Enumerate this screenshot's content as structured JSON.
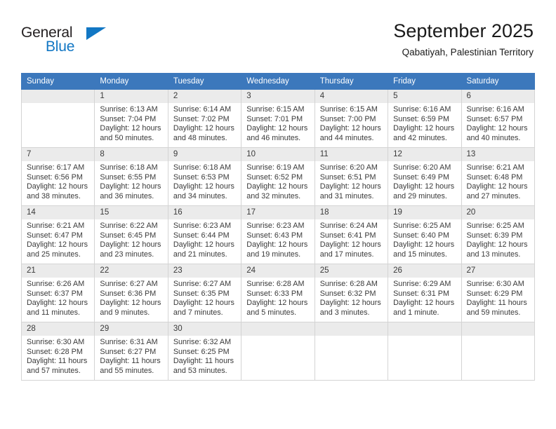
{
  "brand": {
    "name_top": "General",
    "name_bottom": "Blue",
    "accent_color": "#1277c4"
  },
  "header": {
    "title": "September 2025",
    "location": "Qabatiyah, Palestinian Territory"
  },
  "colors": {
    "header_row_bg": "#3c78bc",
    "daynum_bg": "#ebebeb",
    "grid_border": "#d4d4d4",
    "text": "#3a3a3a"
  },
  "weekday_headers": [
    "Sunday",
    "Monday",
    "Tuesday",
    "Wednesday",
    "Thursday",
    "Friday",
    "Saturday"
  ],
  "labels": {
    "sunrise": "Sunrise:",
    "sunset": "Sunset:",
    "daylight": "Daylight:"
  },
  "weeks": [
    [
      {
        "day": "",
        "sunrise": "",
        "sunset": "",
        "daylight_line1": "",
        "daylight_line2": "",
        "empty": true
      },
      {
        "day": "1",
        "sunrise": "Sunrise: 6:13 AM",
        "sunset": "Sunset: 7:04 PM",
        "daylight_line1": "Daylight: 12 hours",
        "daylight_line2": "and 50 minutes."
      },
      {
        "day": "2",
        "sunrise": "Sunrise: 6:14 AM",
        "sunset": "Sunset: 7:02 PM",
        "daylight_line1": "Daylight: 12 hours",
        "daylight_line2": "and 48 minutes."
      },
      {
        "day": "3",
        "sunrise": "Sunrise: 6:15 AM",
        "sunset": "Sunset: 7:01 PM",
        "daylight_line1": "Daylight: 12 hours",
        "daylight_line2": "and 46 minutes."
      },
      {
        "day": "4",
        "sunrise": "Sunrise: 6:15 AM",
        "sunset": "Sunset: 7:00 PM",
        "daylight_line1": "Daylight: 12 hours",
        "daylight_line2": "and 44 minutes."
      },
      {
        "day": "5",
        "sunrise": "Sunrise: 6:16 AM",
        "sunset": "Sunset: 6:59 PM",
        "daylight_line1": "Daylight: 12 hours",
        "daylight_line2": "and 42 minutes."
      },
      {
        "day": "6",
        "sunrise": "Sunrise: 6:16 AM",
        "sunset": "Sunset: 6:57 PM",
        "daylight_line1": "Daylight: 12 hours",
        "daylight_line2": "and 40 minutes."
      }
    ],
    [
      {
        "day": "7",
        "sunrise": "Sunrise: 6:17 AM",
        "sunset": "Sunset: 6:56 PM",
        "daylight_line1": "Daylight: 12 hours",
        "daylight_line2": "and 38 minutes."
      },
      {
        "day": "8",
        "sunrise": "Sunrise: 6:18 AM",
        "sunset": "Sunset: 6:55 PM",
        "daylight_line1": "Daylight: 12 hours",
        "daylight_line2": "and 36 minutes."
      },
      {
        "day": "9",
        "sunrise": "Sunrise: 6:18 AM",
        "sunset": "Sunset: 6:53 PM",
        "daylight_line1": "Daylight: 12 hours",
        "daylight_line2": "and 34 minutes."
      },
      {
        "day": "10",
        "sunrise": "Sunrise: 6:19 AM",
        "sunset": "Sunset: 6:52 PM",
        "daylight_line1": "Daylight: 12 hours",
        "daylight_line2": "and 32 minutes."
      },
      {
        "day": "11",
        "sunrise": "Sunrise: 6:20 AM",
        "sunset": "Sunset: 6:51 PM",
        "daylight_line1": "Daylight: 12 hours",
        "daylight_line2": "and 31 minutes."
      },
      {
        "day": "12",
        "sunrise": "Sunrise: 6:20 AM",
        "sunset": "Sunset: 6:49 PM",
        "daylight_line1": "Daylight: 12 hours",
        "daylight_line2": "and 29 minutes."
      },
      {
        "day": "13",
        "sunrise": "Sunrise: 6:21 AM",
        "sunset": "Sunset: 6:48 PM",
        "daylight_line1": "Daylight: 12 hours",
        "daylight_line2": "and 27 minutes."
      }
    ],
    [
      {
        "day": "14",
        "sunrise": "Sunrise: 6:21 AM",
        "sunset": "Sunset: 6:47 PM",
        "daylight_line1": "Daylight: 12 hours",
        "daylight_line2": "and 25 minutes."
      },
      {
        "day": "15",
        "sunrise": "Sunrise: 6:22 AM",
        "sunset": "Sunset: 6:45 PM",
        "daylight_line1": "Daylight: 12 hours",
        "daylight_line2": "and 23 minutes."
      },
      {
        "day": "16",
        "sunrise": "Sunrise: 6:23 AM",
        "sunset": "Sunset: 6:44 PM",
        "daylight_line1": "Daylight: 12 hours",
        "daylight_line2": "and 21 minutes."
      },
      {
        "day": "17",
        "sunrise": "Sunrise: 6:23 AM",
        "sunset": "Sunset: 6:43 PM",
        "daylight_line1": "Daylight: 12 hours",
        "daylight_line2": "and 19 minutes."
      },
      {
        "day": "18",
        "sunrise": "Sunrise: 6:24 AM",
        "sunset": "Sunset: 6:41 PM",
        "daylight_line1": "Daylight: 12 hours",
        "daylight_line2": "and 17 minutes."
      },
      {
        "day": "19",
        "sunrise": "Sunrise: 6:25 AM",
        "sunset": "Sunset: 6:40 PM",
        "daylight_line1": "Daylight: 12 hours",
        "daylight_line2": "and 15 minutes."
      },
      {
        "day": "20",
        "sunrise": "Sunrise: 6:25 AM",
        "sunset": "Sunset: 6:39 PM",
        "daylight_line1": "Daylight: 12 hours",
        "daylight_line2": "and 13 minutes."
      }
    ],
    [
      {
        "day": "21",
        "sunrise": "Sunrise: 6:26 AM",
        "sunset": "Sunset: 6:37 PM",
        "daylight_line1": "Daylight: 12 hours",
        "daylight_line2": "and 11 minutes."
      },
      {
        "day": "22",
        "sunrise": "Sunrise: 6:27 AM",
        "sunset": "Sunset: 6:36 PM",
        "daylight_line1": "Daylight: 12 hours",
        "daylight_line2": "and 9 minutes."
      },
      {
        "day": "23",
        "sunrise": "Sunrise: 6:27 AM",
        "sunset": "Sunset: 6:35 PM",
        "daylight_line1": "Daylight: 12 hours",
        "daylight_line2": "and 7 minutes."
      },
      {
        "day": "24",
        "sunrise": "Sunrise: 6:28 AM",
        "sunset": "Sunset: 6:33 PM",
        "daylight_line1": "Daylight: 12 hours",
        "daylight_line2": "and 5 minutes."
      },
      {
        "day": "25",
        "sunrise": "Sunrise: 6:28 AM",
        "sunset": "Sunset: 6:32 PM",
        "daylight_line1": "Daylight: 12 hours",
        "daylight_line2": "and 3 minutes."
      },
      {
        "day": "26",
        "sunrise": "Sunrise: 6:29 AM",
        "sunset": "Sunset: 6:31 PM",
        "daylight_line1": "Daylight: 12 hours",
        "daylight_line2": "and 1 minute."
      },
      {
        "day": "27",
        "sunrise": "Sunrise: 6:30 AM",
        "sunset": "Sunset: 6:29 PM",
        "daylight_line1": "Daylight: 11 hours",
        "daylight_line2": "and 59 minutes."
      }
    ],
    [
      {
        "day": "28",
        "sunrise": "Sunrise: 6:30 AM",
        "sunset": "Sunset: 6:28 PM",
        "daylight_line1": "Daylight: 11 hours",
        "daylight_line2": "and 57 minutes."
      },
      {
        "day": "29",
        "sunrise": "Sunrise: 6:31 AM",
        "sunset": "Sunset: 6:27 PM",
        "daylight_line1": "Daylight: 11 hours",
        "daylight_line2": "and 55 minutes."
      },
      {
        "day": "30",
        "sunrise": "Sunrise: 6:32 AM",
        "sunset": "Sunset: 6:25 PM",
        "daylight_line1": "Daylight: 11 hours",
        "daylight_line2": "and 53 minutes."
      },
      {
        "day": "",
        "sunrise": "",
        "sunset": "",
        "daylight_line1": "",
        "daylight_line2": "",
        "empty": true
      },
      {
        "day": "",
        "sunrise": "",
        "sunset": "",
        "daylight_line1": "",
        "daylight_line2": "",
        "empty": true
      },
      {
        "day": "",
        "sunrise": "",
        "sunset": "",
        "daylight_line1": "",
        "daylight_line2": "",
        "empty": true
      },
      {
        "day": "",
        "sunrise": "",
        "sunset": "",
        "daylight_line1": "",
        "daylight_line2": "",
        "empty": true
      }
    ]
  ]
}
